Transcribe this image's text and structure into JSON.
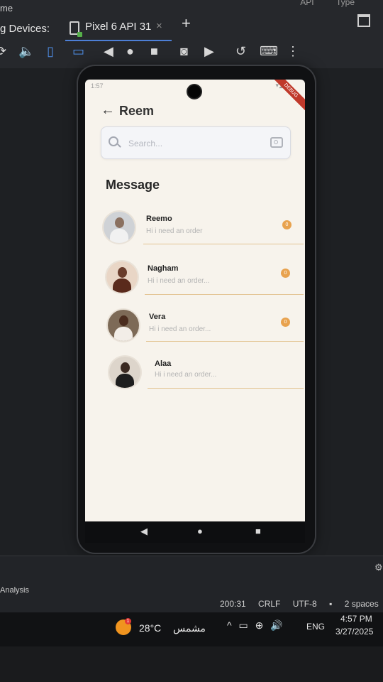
{
  "ide": {
    "menu_left": "me",
    "menu_right": [
      "API",
      "Type"
    ],
    "devices_label": "g Devices:",
    "device_tab_label": "Pixel 6 API 31",
    "device_tab_close": "×",
    "add_tab": "+",
    "toolbar_icons": [
      "rotate-left-icon",
      "volume-icon",
      "rotate-portrait-icon",
      "rotate-landscape-icon",
      "back-icon",
      "home-icon",
      "overview-icon",
      "screenshot-icon",
      "screen-record-icon",
      "replay-icon",
      "keyboard-icon",
      "more-icon"
    ]
  },
  "phone": {
    "status_time": "1:57",
    "status_icons": "▾◢",
    "debug_ribbon": "DEBUG",
    "app": {
      "header_title": "Reem",
      "search_placeholder": "Search...",
      "section_title": "Message",
      "messages": [
        {
          "name": "Reemo",
          "preview": "Hi i need an order",
          "unread": "0"
        },
        {
          "name": "Nagham",
          "preview": "Hi i need an order...",
          "unread": "0"
        },
        {
          "name": "Vera",
          "preview": "Hi i need an order...",
          "unread": "0"
        },
        {
          "name": "Alaa",
          "preview": "Hi i need an order..."
        }
      ]
    },
    "nav": {
      "back": "◀",
      "home": "●",
      "recents": "■"
    }
  },
  "ide_bottom": {
    "analysis_label": "Analysis",
    "cursor_position": "200:31",
    "line_separator": "CRLF",
    "encoding": "UTF-8",
    "indent": "2 spaces"
  },
  "taskbar": {
    "weather_badge": "1",
    "temperature": "28°C",
    "weather_desc": "مشمس",
    "language": "ENG",
    "time": "4:57 PM",
    "date": "3/27/2025"
  },
  "colors": {
    "accent": "#e8a24e",
    "screen_bg": "#f7f3ec",
    "ide_bg": "#1e2023",
    "divider": "#e3c493"
  }
}
